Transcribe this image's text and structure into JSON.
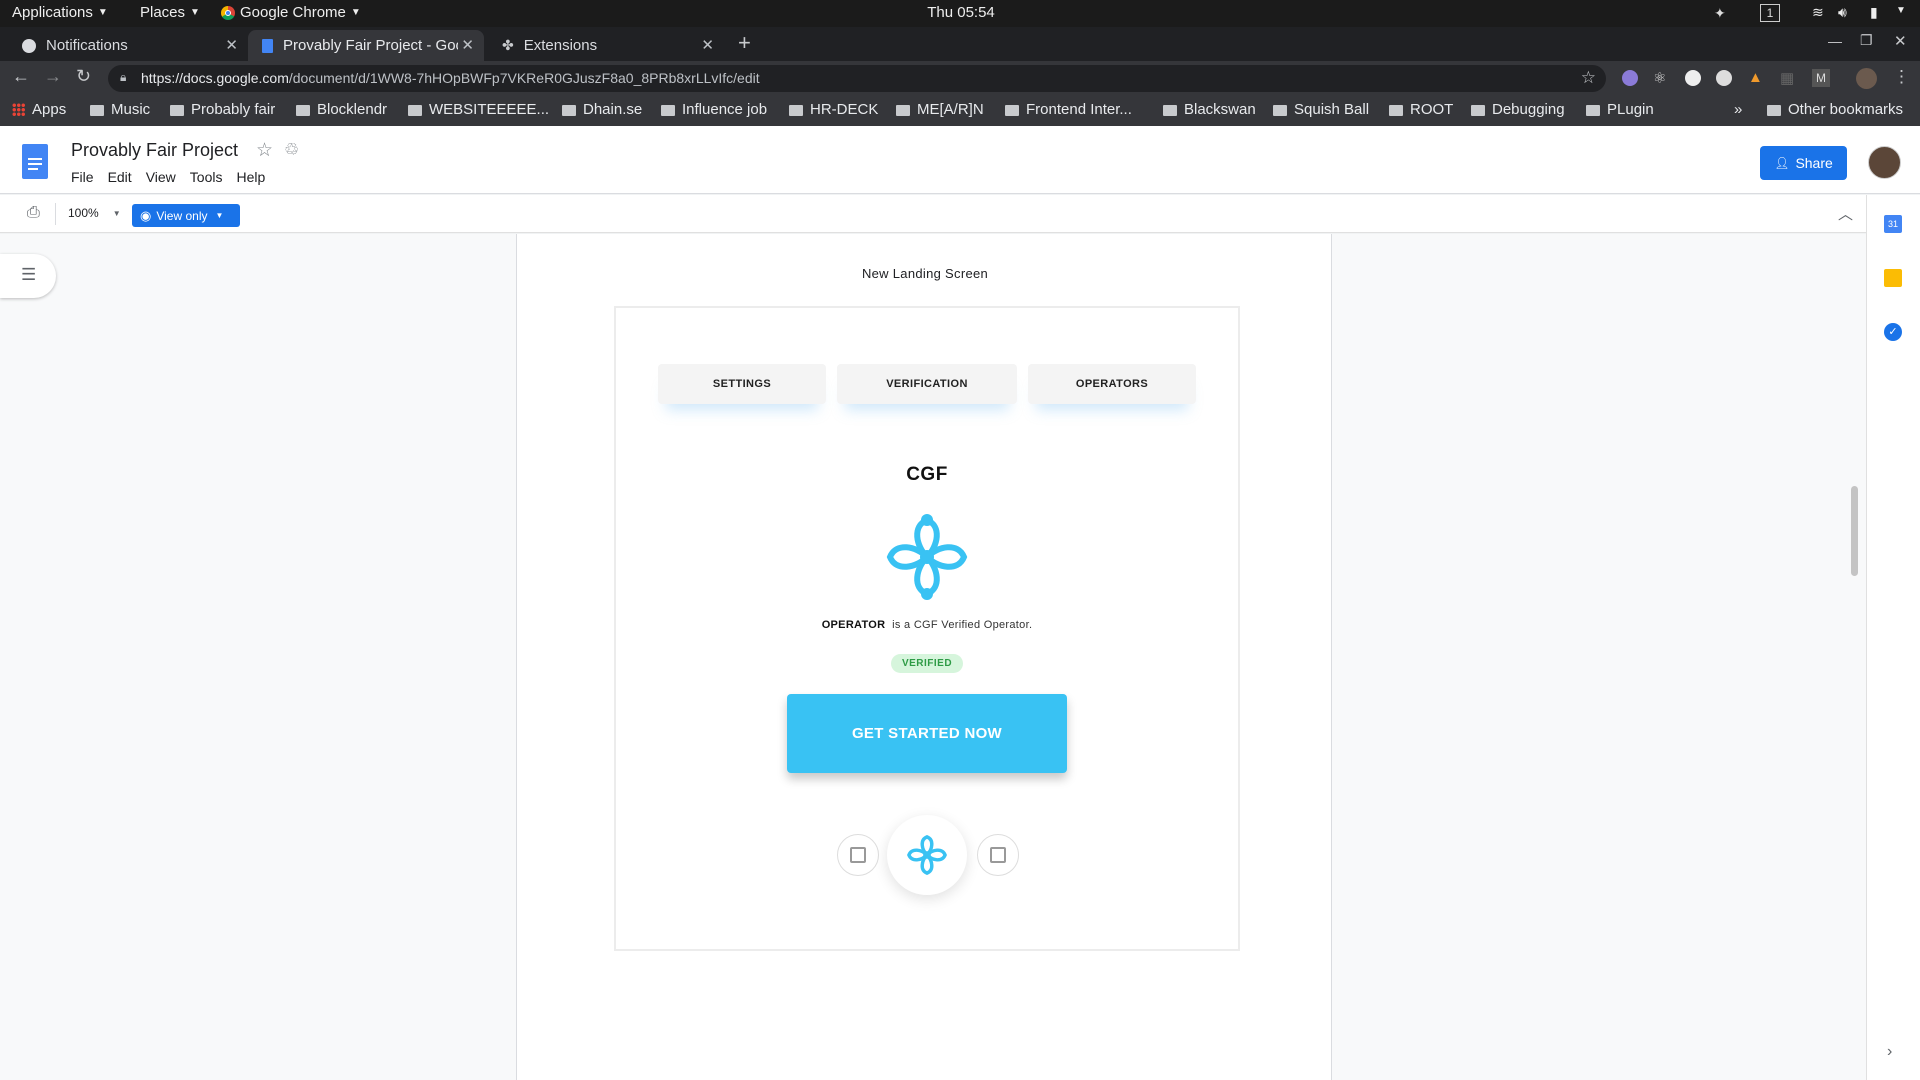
{
  "system_bar": {
    "applications": "Applications",
    "places": "Places",
    "chrome": "Google Chrome",
    "clock": "Thu 05:54",
    "workspace": "1"
  },
  "tabs": [
    {
      "label": "Notifications"
    },
    {
      "label": "Provably Fair Project - Goo"
    },
    {
      "label": "Extensions"
    }
  ],
  "address_bar": {
    "url_prefix": "https://docs.google.com",
    "url_path": "/document/d/1WW8-7hHOpBWFp7VKReR0GJuszF8a0_8PRb8xrLLvIfc/edit"
  },
  "bookmarks": {
    "apps": "Apps",
    "items": [
      "Music",
      "Probably fair",
      "Blocklendr",
      "WEBSITEEEEE...",
      "Dhain.se",
      "Influence job",
      "HR-DECK",
      "ME[A/R]N",
      "Frontend Inter...",
      "Blackswan",
      "Squish Ball",
      "ROOT",
      "Debugging",
      "PLugin"
    ],
    "overflow": "»",
    "other": "Other bookmarks"
  },
  "docs": {
    "title": "Provably Fair Project",
    "menu": [
      "File",
      "Edit",
      "View",
      "Tools",
      "Help"
    ],
    "share": "Share",
    "zoom": "100%",
    "mode": "View only",
    "calendar_day": "31"
  },
  "content": {
    "heading": "New Landing Screen",
    "tabs": [
      "SETTINGS",
      "VERIFICATION",
      "OPERATORS"
    ],
    "brand": "CGF",
    "operator_name": "OPERATOR",
    "operator_text": "is a CGF Verified Operator.",
    "badge": "VERIFIED",
    "cta": "GET STARTED NOW"
  },
  "colors": {
    "accent_blue": "#39c2f3",
    "share_blue": "#1a73e8",
    "docs_blue": "#4285f4",
    "verified_green": "#2e9b46"
  }
}
